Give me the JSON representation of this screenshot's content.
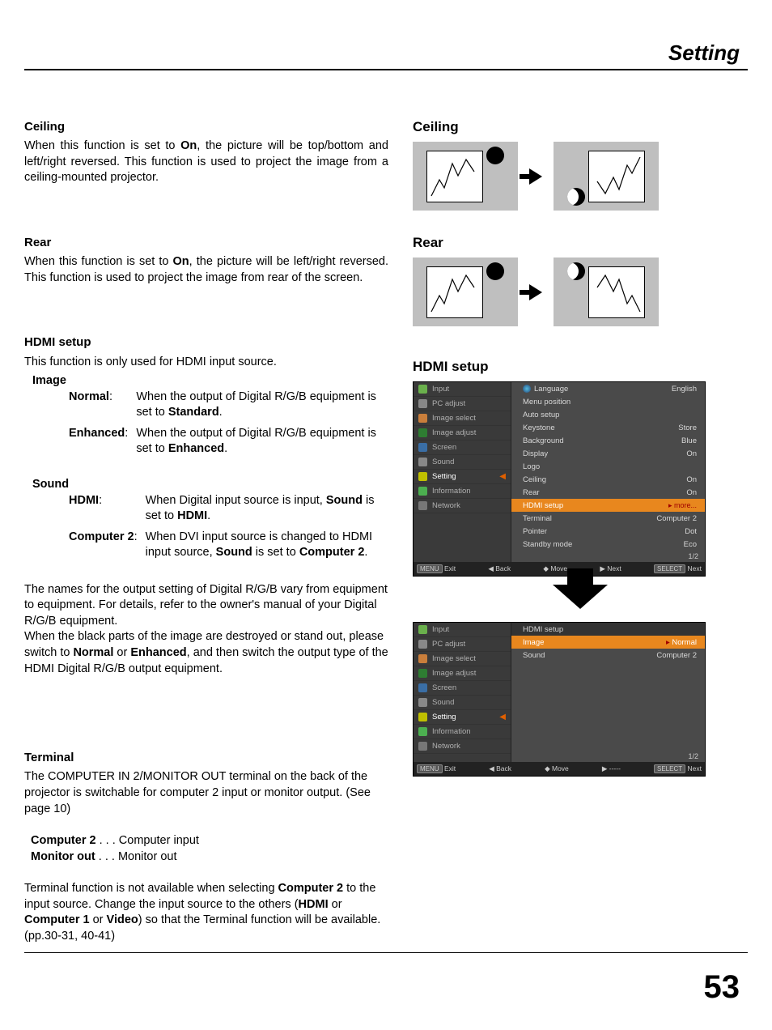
{
  "header": {
    "title": "Setting"
  },
  "page_number": "53",
  "left": {
    "ceiling": {
      "head": "Ceiling",
      "p1_a": "When this function is set to ",
      "p1_on": "On",
      "p1_b": ", the picture will be top/bottom and left/right reversed. This function is used to project the image from a ceiling-mounted projector."
    },
    "rear": {
      "head": "Rear",
      "p1_a": "When this function is set to ",
      "p1_on": "On",
      "p1_b": ", the picture will be left/right reversed. This function is used to project the image from rear of the screen."
    },
    "hdmi": {
      "head": "HDMI setup",
      "intro": "This function is only used for HDMI input source.",
      "image_head": "Image",
      "image_defs": [
        {
          "term": "Normal",
          "colon": ":",
          "text_a": "When the output of Digital R/G/B equipment is set to ",
          "text_bold": "Standard",
          "text_b": "."
        },
        {
          "term": "Enhanced",
          "colon": ":",
          "text_a": "When the output of Digital R/G/B equipment is set to ",
          "text_bold": "Enhanced",
          "text_b": "."
        }
      ],
      "sound_head": "Sound",
      "sound_defs": [
        {
          "term": "HDMI",
          "colon": ":",
          "text_a": "When Digital input source is input, ",
          "text_bold1": "Sound",
          "text_mid": " is set to ",
          "text_bold2": "HDMI",
          "text_end": "."
        },
        {
          "term": "Computer 2",
          "colon": ":",
          "text_a": "When DVI input source is changed to HDMI input source, ",
          "text_bold1": "Sound",
          "text_mid": " is set to ",
          "text_bold2": "Computer 2",
          "text_end": "."
        }
      ],
      "note_a": "The names for the output setting of Digital R/G/B vary from equipment to equipment. For details, refer to the owner's manual of your Digital R/G/B equipment.",
      "note_b1": "When the black parts of the image are destroyed or stand out, please switch to ",
      "note_b_bold1": "Normal",
      "note_b_mid": " or ",
      "note_b_bold2": "Enhanced",
      "note_b2": ", and then switch the output type of the HDMI Digital R/G/B output equipment."
    },
    "terminal": {
      "head": "Terminal",
      "p1": "The COMPUTER IN 2/MONITOR OUT terminal on the back of the projector is switchable for computer 2 input or monitor output. (See page 10)",
      "list": [
        {
          "term": "Computer 2",
          "dots": " . . .  ",
          "text": "Computer input"
        },
        {
          "term": "Monitor out",
          "dots": " . . .  ",
          "text": "Monitor out"
        }
      ],
      "p2_a": "Terminal function is not available when selecting ",
      "p2_b1": "Computer 2",
      "p2_b": " to the input source. Change the input source to the others (",
      "p2_b2": "HDMI",
      "p2_or1": " or ",
      "p2_b3": "Computer 1",
      "p2_or2": " or ",
      "p2_b4": "Video",
      "p2_c": ") so that the Terminal function will be available. (pp.30-31, 40-41)"
    }
  },
  "right": {
    "ceiling_head": "Ceiling",
    "rear_head": "Rear",
    "hdmi_head": "HDMI setup",
    "osd_nav": [
      {
        "label": "Input",
        "icon": "#6ab04c"
      },
      {
        "label": "PC adjust",
        "icon": "#888"
      },
      {
        "label": "Image select",
        "icon": "#c97e3b"
      },
      {
        "label": "Image adjust",
        "icon": "#2e7d32"
      },
      {
        "label": "Screen",
        "icon": "#3a6ea5"
      },
      {
        "label": "Sound",
        "icon": "#888"
      },
      {
        "label": "Setting",
        "icon": "#c0c000",
        "active": true
      },
      {
        "label": "Information",
        "icon": "#4caf50"
      },
      {
        "label": "Network",
        "icon": "#777"
      }
    ],
    "osd1_items": [
      {
        "l": "Language",
        "r": "English",
        "icon": true
      },
      {
        "l": "Menu position",
        "r": ""
      },
      {
        "l": "Auto setup",
        "r": ""
      },
      {
        "l": "Keystone",
        "r": "Store"
      },
      {
        "l": "Background",
        "r": "Blue"
      },
      {
        "l": "Display",
        "r": "On"
      },
      {
        "l": "Logo",
        "r": ""
      },
      {
        "l": "Ceiling",
        "r": "On"
      },
      {
        "l": "Rear",
        "r": "On"
      },
      {
        "l": "HDMI setup",
        "r": "more...",
        "hl": true,
        "more": true
      },
      {
        "l": "Terminal",
        "r": "Computer 2"
      },
      {
        "l": "Pointer",
        "r": "Dot"
      },
      {
        "l": "Standby mode",
        "r": "Eco"
      }
    ],
    "osd1_pager": "1/2",
    "osd1_footer": {
      "exit": "Exit",
      "back": "Back",
      "move": "Move",
      "next": "Next",
      "sel": "Next",
      "menu": "MENU",
      "select": "SELECT"
    },
    "osd2_title": "HDMI setup",
    "osd2_items": [
      {
        "l": "Image",
        "r": "Normal",
        "hl": true,
        "more": true
      },
      {
        "l": "Sound",
        "r": "Computer 2"
      }
    ],
    "osd2_pager": "1/2",
    "osd2_footer": {
      "exit": "Exit",
      "back": "Back",
      "move": "Move",
      "next": "-----",
      "sel": "Next",
      "menu": "MENU",
      "select": "SELECT"
    }
  }
}
